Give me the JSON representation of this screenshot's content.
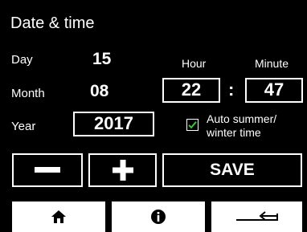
{
  "header": {
    "title": "Date & time"
  },
  "date": {
    "day_label": "Day",
    "day_value": "15",
    "month_label": "Month",
    "month_value": "08",
    "year_label": "Year",
    "year_value": "2017"
  },
  "time": {
    "hour_label": "Hour",
    "minute_label": "Minute",
    "hour_value": "22",
    "separator": ":",
    "minute_value": "47"
  },
  "auto_dst": {
    "checked": true,
    "label_line1": "Auto summer/",
    "label_line2": "winter time"
  },
  "controls": {
    "minus_label": "−",
    "plus_label": "+",
    "save_label": "SAVE"
  },
  "nav": {
    "home_icon": "home-icon",
    "info_icon": "info-icon",
    "back_icon": "back-arrow-icon"
  },
  "colors": {
    "background": "#000000",
    "foreground": "#ffffff",
    "check_accent": "#3cc53c"
  }
}
